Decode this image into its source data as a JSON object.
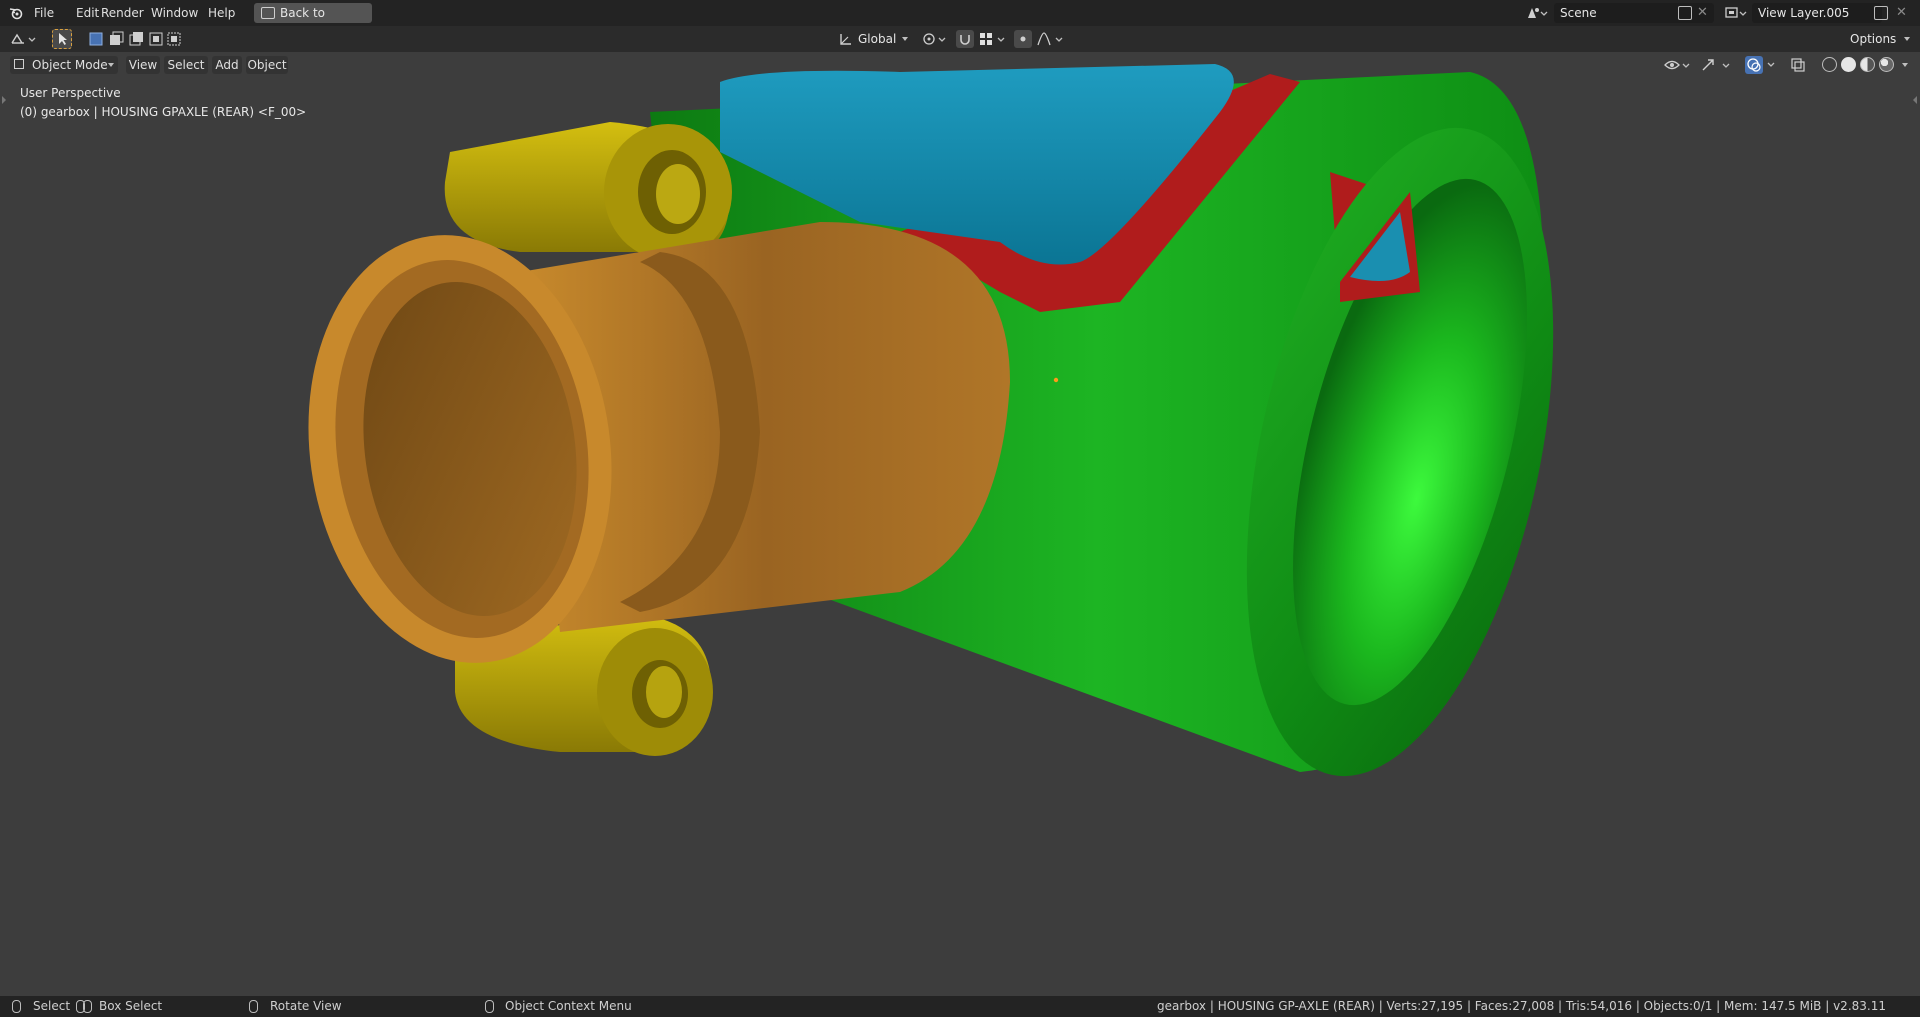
{
  "menu": {
    "file": "File",
    "edit": "Edit",
    "render": "Render",
    "window": "Window",
    "help": "Help",
    "back_to_previous": "Back to Previous"
  },
  "scene": {
    "name": "Scene"
  },
  "view_layer": {
    "name": "View Layer.005"
  },
  "tool_header": {
    "transform_orientation": "Global",
    "options": "Options"
  },
  "viewport_header": {
    "mode": "Object Mode",
    "view": "View",
    "select": "Select",
    "add": "Add",
    "object": "Object"
  },
  "overlay": {
    "perspective": "User Perspective",
    "object_info": "(0) gearbox | HOUSING GPAXLE (REAR) <F_00>"
  },
  "status": {
    "select": "Select",
    "box_select": "Box Select",
    "rotate_view": "Rotate View",
    "context_menu": "Object Context Menu",
    "stats": "gearbox | HOUSING GP-AXLE (REAR) | Verts:27,195 | Faces:27,008 | Tris:54,016 | Objects:0/1 | Mem: 147.5 MiB | v2.83.11"
  },
  "colors": {
    "housing_green": "#1fa81f",
    "flange_orange": "#c98a2a",
    "boss_yellow": "#c9b40a",
    "cover_blue": "#1a8fb0",
    "gasket_red": "#b01c1c",
    "viewport_bg": "#3d3d3d",
    "active_blue": "#4772b3"
  },
  "icons": [
    "blender-logo-icon",
    "editor-type-icon",
    "select-tweak-icon",
    "select-mode-icons",
    "transform-orientation-icon",
    "pivot-icon",
    "snap-icon",
    "snap-target-icon",
    "proportional-edit-icon",
    "falloff-icon",
    "object-mode-icon",
    "visibility-icon",
    "gizmo-icon",
    "overlay-icon",
    "xray-icon",
    "wireframe-shading-icon",
    "solid-shading-icon",
    "material-shading-icon",
    "rendered-shading-icon",
    "scene-icon",
    "view-layer-icon",
    "new-scene-icon",
    "remove-icon",
    "mouse-icon"
  ]
}
